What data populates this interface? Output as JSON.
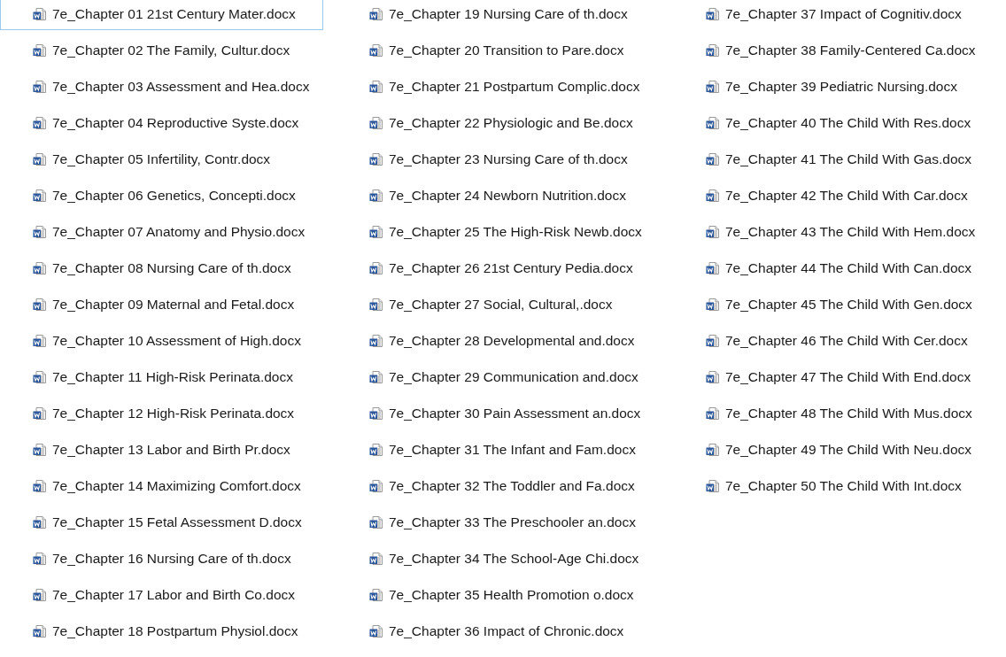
{
  "files": [
    {
      "name": "7e_Chapter 01 21st Century Mater.docx",
      "focused": true
    },
    {
      "name": "7e_Chapter 02 The Family, Cultur.docx",
      "focused": false
    },
    {
      "name": "7e_Chapter 03 Assessment and Hea.docx",
      "focused": false
    },
    {
      "name": "7e_Chapter 04 Reproductive Syste.docx",
      "focused": false
    },
    {
      "name": "7e_Chapter 05 Infertility, Contr.docx",
      "focused": false
    },
    {
      "name": "7e_Chapter 06 Genetics, Concepti.docx",
      "focused": false
    },
    {
      "name": "7e_Chapter 07 Anatomy and Physio.docx",
      "focused": false
    },
    {
      "name": "7e_Chapter 08 Nursing Care of th.docx",
      "focused": false
    },
    {
      "name": "7e_Chapter 09 Maternal and Fetal.docx",
      "focused": false
    },
    {
      "name": "7e_Chapter 10 Assessment of High.docx",
      "focused": false
    },
    {
      "name": "7e_Chapter 11 High-Risk Perinata.docx",
      "focused": false
    },
    {
      "name": "7e_Chapter 12 High-Risk Perinata.docx",
      "focused": false
    },
    {
      "name": "7e_Chapter 13 Labor and Birth Pr.docx",
      "focused": false
    },
    {
      "name": "7e_Chapter 14 Maximizing Comfort.docx",
      "focused": false
    },
    {
      "name": "7e_Chapter 15 Fetal Assessment D.docx",
      "focused": false
    },
    {
      "name": "7e_Chapter 16 Nursing Care of th.docx",
      "focused": false
    },
    {
      "name": "7e_Chapter 17 Labor and Birth Co.docx",
      "focused": false
    },
    {
      "name": "7e_Chapter 18 Postpartum Physiol.docx",
      "focused": false
    },
    {
      "name": "7e_Chapter 19 Nursing Care of th.docx",
      "focused": false
    },
    {
      "name": "7e_Chapter 20 Transition to Pare.docx",
      "focused": false
    },
    {
      "name": "7e_Chapter 21 Postpartum Complic.docx",
      "focused": false
    },
    {
      "name": "7e_Chapter 22 Physiologic and Be.docx",
      "focused": false
    },
    {
      "name": "7e_Chapter 23 Nursing Care of th.docx",
      "focused": false
    },
    {
      "name": "7e_Chapter 24 Newborn Nutrition.docx",
      "focused": false
    },
    {
      "name": "7e_Chapter 25 The High-Risk Newb.docx",
      "focused": false
    },
    {
      "name": "7e_Chapter 26 21st Century Pedia.docx",
      "focused": false
    },
    {
      "name": "7e_Chapter 27 Social, Cultural,.docx",
      "focused": false
    },
    {
      "name": "7e_Chapter 28 Developmental and.docx",
      "focused": false
    },
    {
      "name": "7e_Chapter 29 Communication and.docx",
      "focused": false
    },
    {
      "name": "7e_Chapter 30 Pain Assessment an.docx",
      "focused": false
    },
    {
      "name": "7e_Chapter 31 The Infant and Fam.docx",
      "focused": false
    },
    {
      "name": "7e_Chapter 32 The Toddler and Fa.docx",
      "focused": false
    },
    {
      "name": "7e_Chapter 33 The Preschooler an.docx",
      "focused": false
    },
    {
      "name": "7e_Chapter 34 The School-Age Chi.docx",
      "focused": false
    },
    {
      "name": "7e_Chapter 35 Health Promotion o.docx",
      "focused": false
    },
    {
      "name": "7e_Chapter 36 Impact of Chronic.docx",
      "focused": false
    },
    {
      "name": "7e_Chapter 37 Impact of Cognitiv.docx",
      "focused": false
    },
    {
      "name": "7e_Chapter 38 Family-Centered Ca.docx",
      "focused": false
    },
    {
      "name": "7e_Chapter 39 Pediatric Nursing.docx",
      "focused": false
    },
    {
      "name": "7e_Chapter 40 The Child With Res.docx",
      "focused": false
    },
    {
      "name": "7e_Chapter 41 The Child With Gas.docx",
      "focused": false
    },
    {
      "name": "7e_Chapter 42 The Child With Car.docx",
      "focused": false
    },
    {
      "name": "7e_Chapter 43 The Child With Hem.docx",
      "focused": false
    },
    {
      "name": "7e_Chapter 44 The Child With Can.docx",
      "focused": false
    },
    {
      "name": "7e_Chapter 45 The Child With Gen.docx",
      "focused": false
    },
    {
      "name": "7e_Chapter 46 The Child With Cer.docx",
      "focused": false
    },
    {
      "name": "7e_Chapter 47 The Child With End.docx",
      "focused": false
    },
    {
      "name": "7e_Chapter 48 The Child With Mus.docx",
      "focused": false
    },
    {
      "name": "7e_Chapter 49 The Child With Neu.docx",
      "focused": false
    },
    {
      "name": "7e_Chapter 50 The Child With Int.docx",
      "focused": false
    }
  ]
}
